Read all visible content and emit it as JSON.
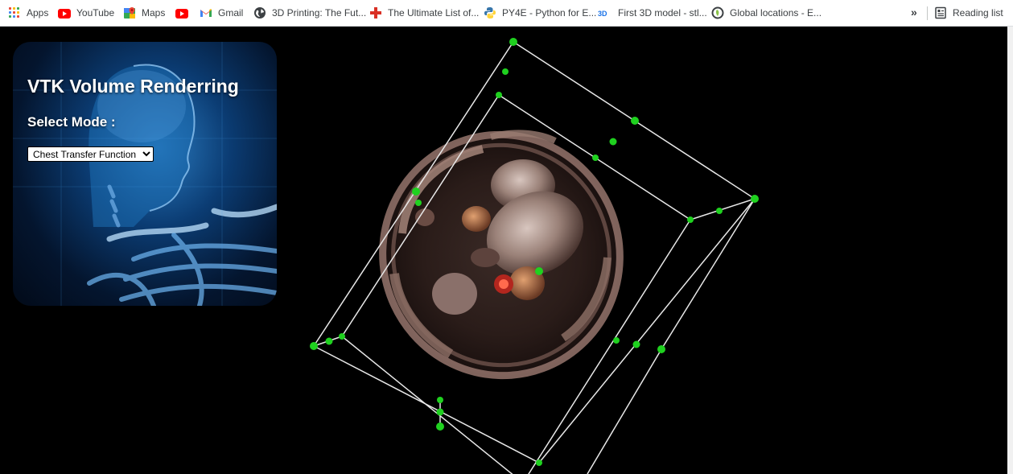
{
  "bookmarks": [
    {
      "label": "Apps",
      "icon": "apps-grid-icon"
    },
    {
      "label": "YouTube",
      "icon": "youtube-icon"
    },
    {
      "label": "Maps",
      "icon": "google-maps-icon"
    },
    {
      "label": "",
      "icon": "youtube-icon"
    },
    {
      "label": "Gmail",
      "icon": "gmail-icon"
    },
    {
      "label": "3D Printing: The Fut...",
      "icon": "globe-icon"
    },
    {
      "label": "The Ultimate List of...",
      "icon": "red-cross-icon"
    },
    {
      "label": "PY4E - Python for E...",
      "icon": "python-icon"
    },
    {
      "label": "First 3D model - stl...",
      "icon": "3d-logo-icon"
    },
    {
      "label": "Global locations - E...",
      "icon": "leaf-icon"
    }
  ],
  "overflow_label": "»",
  "reading_list": {
    "label": "Reading list",
    "icon": "reading-list-icon"
  },
  "panel": {
    "title": "VTK Volume Renderring",
    "select_label": "Select Mode :",
    "select_value": "Chest Transfer Function",
    "select_options": [
      "Chest Transfer Function"
    ]
  },
  "colors": {
    "bookmark_text": "#3c4043",
    "viewport_bg": "#000000",
    "widget_handle": "#1fd11f",
    "widget_line": "#e8e8e8",
    "tissue": "#7a5a52"
  }
}
